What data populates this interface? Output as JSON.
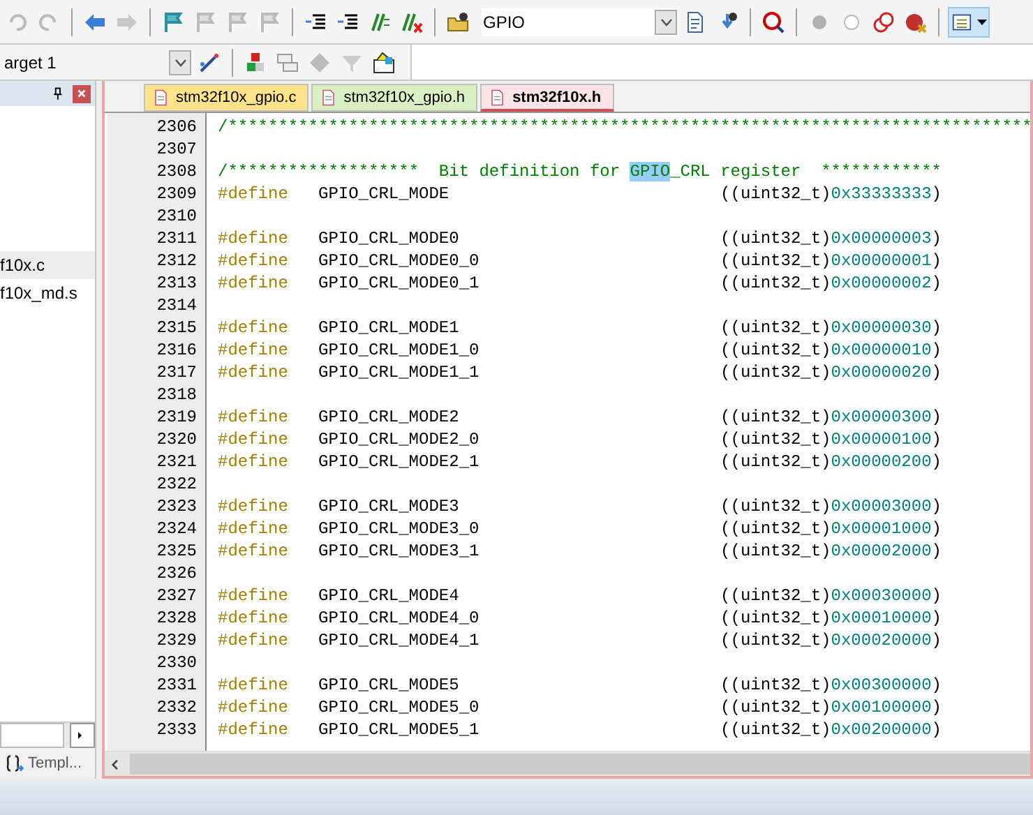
{
  "toolbar": {
    "symbol_field": {
      "value": "GPIO"
    }
  },
  "build_toolbar": {
    "target_field": {
      "value": "arget 1"
    }
  },
  "project_panel": {
    "items": [
      {
        "label": "f10x.c",
        "selected": true
      },
      {
        "label": "f10x_md.s",
        "selected": false
      }
    ],
    "bottom_tab": {
      "label": "Templ..."
    }
  },
  "editor": {
    "tabs": [
      {
        "label": "stm32f10x_gpio.c",
        "selected": false,
        "color": "#ffe38a"
      },
      {
        "label": "stm32f10x_gpio.h",
        "selected": false,
        "color": "#d9efc4"
      },
      {
        "label": "stm32f10x.h",
        "selected": true,
        "color": "#fbe4e8"
      }
    ],
    "lines": [
      {
        "number": "2306",
        "kind": "comment",
        "text": "/********************************************************************************"
      },
      {
        "number": "2307",
        "kind": "blank"
      },
      {
        "number": "2308",
        "kind": "heading",
        "before": "/*******************  Bit definition for ",
        "highlight": "GPIO",
        "after": "_CRL register  ************"
      },
      {
        "number": "2309",
        "kind": "define",
        "keyword": "#define",
        "name": "GPIO_CRL_MODE",
        "cast": "((uint32_t)",
        "value": "0x33333333",
        "close": ")"
      },
      {
        "number": "2310",
        "kind": "blank"
      },
      {
        "number": "2311",
        "kind": "define",
        "keyword": "#define",
        "name": "GPIO_CRL_MODE0",
        "cast": "((uint32_t)",
        "value": "0x00000003",
        "close": ")"
      },
      {
        "number": "2312",
        "kind": "define",
        "keyword": "#define",
        "name": "GPIO_CRL_MODE0_0",
        "cast": "((uint32_t)",
        "value": "0x00000001",
        "close": ")"
      },
      {
        "number": "2313",
        "kind": "define",
        "keyword": "#define",
        "name": "GPIO_CRL_MODE0_1",
        "cast": "((uint32_t)",
        "value": "0x00000002",
        "close": ")"
      },
      {
        "number": "2314",
        "kind": "blank"
      },
      {
        "number": "2315",
        "kind": "define",
        "keyword": "#define",
        "name": "GPIO_CRL_MODE1",
        "cast": "((uint32_t)",
        "value": "0x00000030",
        "close": ")"
      },
      {
        "number": "2316",
        "kind": "define",
        "keyword": "#define",
        "name": "GPIO_CRL_MODE1_0",
        "cast": "((uint32_t)",
        "value": "0x00000010",
        "close": ")"
      },
      {
        "number": "2317",
        "kind": "define",
        "keyword": "#define",
        "name": "GPIO_CRL_MODE1_1",
        "cast": "((uint32_t)",
        "value": "0x00000020",
        "close": ")"
      },
      {
        "number": "2318",
        "kind": "blank"
      },
      {
        "number": "2319",
        "kind": "define",
        "keyword": "#define",
        "name": "GPIO_CRL_MODE2",
        "cast": "((uint32_t)",
        "value": "0x00000300",
        "close": ")"
      },
      {
        "number": "2320",
        "kind": "define",
        "keyword": "#define",
        "name": "GPIO_CRL_MODE2_0",
        "cast": "((uint32_t)",
        "value": "0x00000100",
        "close": ")"
      },
      {
        "number": "2321",
        "kind": "define",
        "keyword": "#define",
        "name": "GPIO_CRL_MODE2_1",
        "cast": "((uint32_t)",
        "value": "0x00000200",
        "close": ")"
      },
      {
        "number": "2322",
        "kind": "blank"
      },
      {
        "number": "2323",
        "kind": "define",
        "keyword": "#define",
        "name": "GPIO_CRL_MODE3",
        "cast": "((uint32_t)",
        "value": "0x00003000",
        "close": ")"
      },
      {
        "number": "2324",
        "kind": "define",
        "keyword": "#define",
        "name": "GPIO_CRL_MODE3_0",
        "cast": "((uint32_t)",
        "value": "0x00001000",
        "close": ")"
      },
      {
        "number": "2325",
        "kind": "define",
        "keyword": "#define",
        "name": "GPIO_CRL_MODE3_1",
        "cast": "((uint32_t)",
        "value": "0x00002000",
        "close": ")"
      },
      {
        "number": "2326",
        "kind": "blank"
      },
      {
        "number": "2327",
        "kind": "define",
        "keyword": "#define",
        "name": "GPIO_CRL_MODE4",
        "cast": "((uint32_t)",
        "value": "0x00030000",
        "close": ")"
      },
      {
        "number": "2328",
        "kind": "define",
        "keyword": "#define",
        "name": "GPIO_CRL_MODE4_0",
        "cast": "((uint32_t)",
        "value": "0x00010000",
        "close": ")"
      },
      {
        "number": "2329",
        "kind": "define",
        "keyword": "#define",
        "name": "GPIO_CRL_MODE4_1",
        "cast": "((uint32_t)",
        "value": "0x00020000",
        "close": ")"
      },
      {
        "number": "2330",
        "kind": "blank"
      },
      {
        "number": "2331",
        "kind": "define",
        "keyword": "#define",
        "name": "GPIO_CRL_MODE5",
        "cast": "((uint32_t)",
        "value": "0x00300000",
        "close": ")"
      },
      {
        "number": "2332",
        "kind": "define",
        "keyword": "#define",
        "name": "GPIO_CRL_MODE5_0",
        "cast": "((uint32_t)",
        "value": "0x00100000",
        "close": ")"
      },
      {
        "number": "2333",
        "kind": "define",
        "keyword": "#define",
        "name": "GPIO_CRL_MODE5_1",
        "cast": "((uint32_t)",
        "value": "0x00200000",
        "close": ")"
      }
    ]
  }
}
